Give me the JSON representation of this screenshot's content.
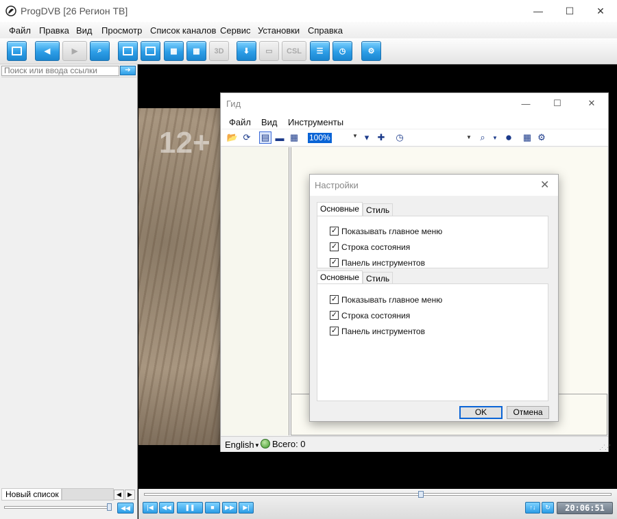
{
  "window": {
    "title": "ProgDVB [26 Регион ТВ]",
    "controls": {
      "minimize": "—",
      "maximize": "☐",
      "close": "✕"
    }
  },
  "menu": [
    "Файл",
    "Правка",
    "Вид",
    "Просмотр",
    "Список каналов",
    "Сервис",
    "Установки",
    "Справка"
  ],
  "toolbar": {
    "label_3d": "3D",
    "label_csl": "CSL",
    "icons": [
      "window-icon",
      "back-icon",
      "forward-icon",
      "zoom-icon",
      "single-view-icon",
      "pip-view-icon",
      "quad-view-icon",
      "grid-view-icon",
      "3d-icon",
      "record-icon",
      "monitor-icon",
      "csl-icon",
      "channel-list-icon",
      "schedule-icon",
      "settings-gear-icon"
    ]
  },
  "left_panel": {
    "search_placeholder": "Поиск или ввода ссылки",
    "list_tab": "Новый список"
  },
  "video": {
    "age_rating": "12+"
  },
  "player": {
    "time": "20:06:51"
  },
  "guide": {
    "title": "Гид",
    "menu": [
      "Файл",
      "Вид",
      "Инструменты"
    ],
    "zoom": "100%",
    "language": "English",
    "total": "Всего: 0"
  },
  "settings": {
    "title": "Настройки",
    "tabs": [
      "Основные",
      "Стиль"
    ],
    "options": [
      {
        "label": "Показывать главное меню",
        "checked": true
      },
      {
        "label": "Строка состояния",
        "checked": true
      },
      {
        "label": "Панель инструментов",
        "checked": true
      }
    ],
    "ok_label": "OK",
    "cancel_label": "Отмена"
  }
}
